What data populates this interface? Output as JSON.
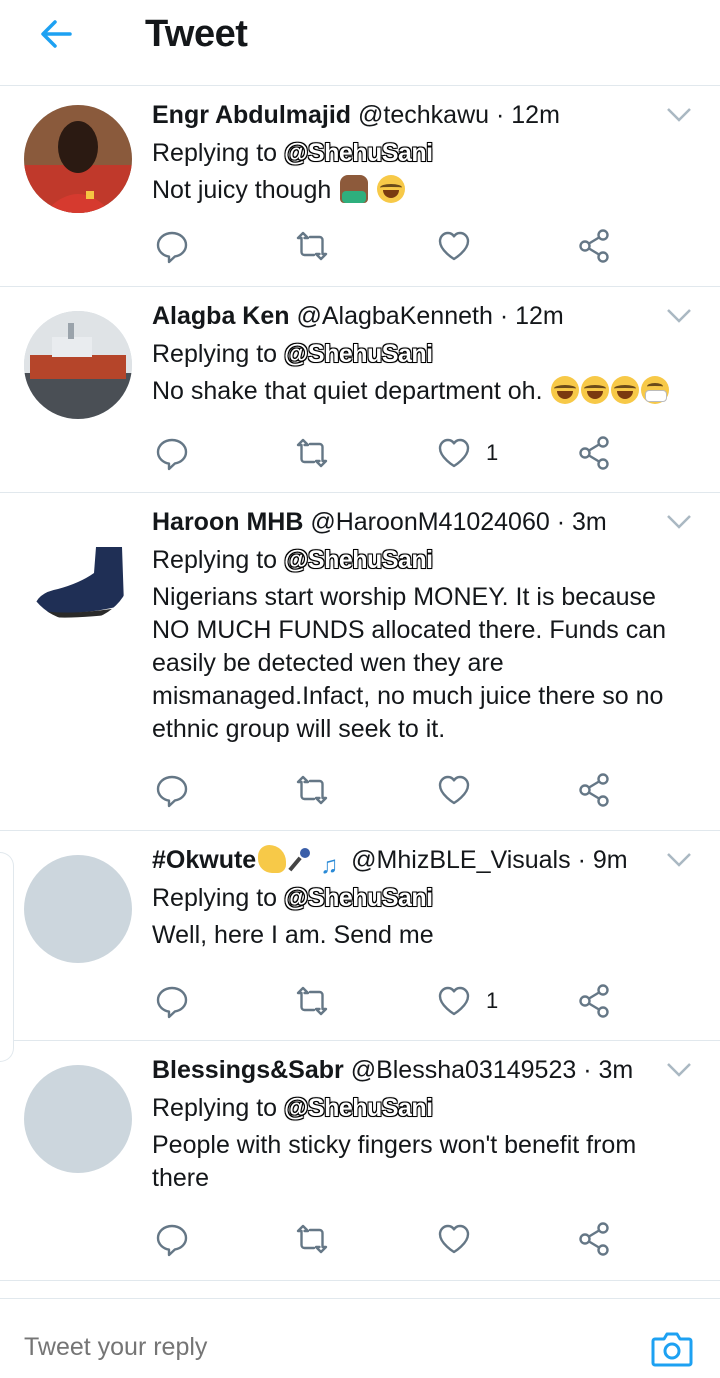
{
  "header": {
    "title": "Tweet",
    "back_icon": "arrow-left-icon",
    "accent": "#1da1f2"
  },
  "reply_prefix": "Replying to",
  "tweets": [
    {
      "name": "Engr Abdulmajid",
      "handle": "@techkawu",
      "time": "12m",
      "mention": "@ShehuSani",
      "text": "Not juicy though",
      "emojis": [
        "person-shrugging",
        "face-with-tears-of-joy"
      ],
      "likes": ""
    },
    {
      "name": "Alagba Ken",
      "handle": "@AlagbaKenneth",
      "time": "12m",
      "mention": "@ShehuSani",
      "text": "No shake that quiet department oh.",
      "emojis": [
        "face-with-tears-of-joy",
        "face-with-tears-of-joy",
        "face-with-tears-of-joy",
        "face-with-medical-mask"
      ],
      "likes": "1"
    },
    {
      "name": "Haroon MHB",
      "handle": "@HaroonM41024060",
      "time": "3m",
      "mention": "@ShehuSani",
      "text": "Nigerians start worship MONEY. It is because NO MUCH FUNDS allocated there. Funds can easily be detected wen they are  mismanaged.Infact, no much juice there so no ethnic group will seek to it.",
      "emojis": [],
      "likes": ""
    },
    {
      "name": "#Okwute",
      "name_emojis": [
        "flexed-biceps",
        "microphone",
        "musical-notes"
      ],
      "handle": "@MhizBLE_Visuals",
      "time": "9m",
      "mention": "@ShehuSani",
      "text": "Well, here I am. Send me",
      "emojis": [],
      "likes": "1"
    },
    {
      "name": "Blessings&Sabr",
      "handle": "@Blessha03149523",
      "time": "3m",
      "mention": "@ShehuSani",
      "text": "People with sticky fingers won't benefit from there",
      "emojis": [],
      "likes": ""
    }
  ],
  "reply_bar": {
    "placeholder": "Tweet your reply",
    "camera_icon": "camera-icon"
  },
  "icons": {
    "reply": "reply-icon",
    "retweet": "retweet-icon",
    "like": "heart-icon",
    "share": "share-icon",
    "more": "chevron-down-icon"
  }
}
